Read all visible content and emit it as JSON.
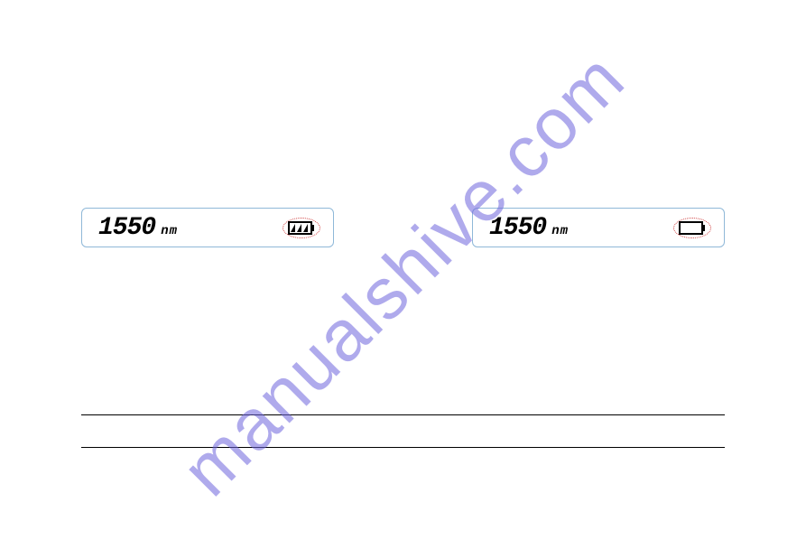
{
  "watermark": "manualshive.com",
  "displays": [
    {
      "value": "1550",
      "unit": "nm",
      "battery": "full"
    },
    {
      "value": "1550",
      "unit": "nm",
      "battery": "empty"
    }
  ]
}
